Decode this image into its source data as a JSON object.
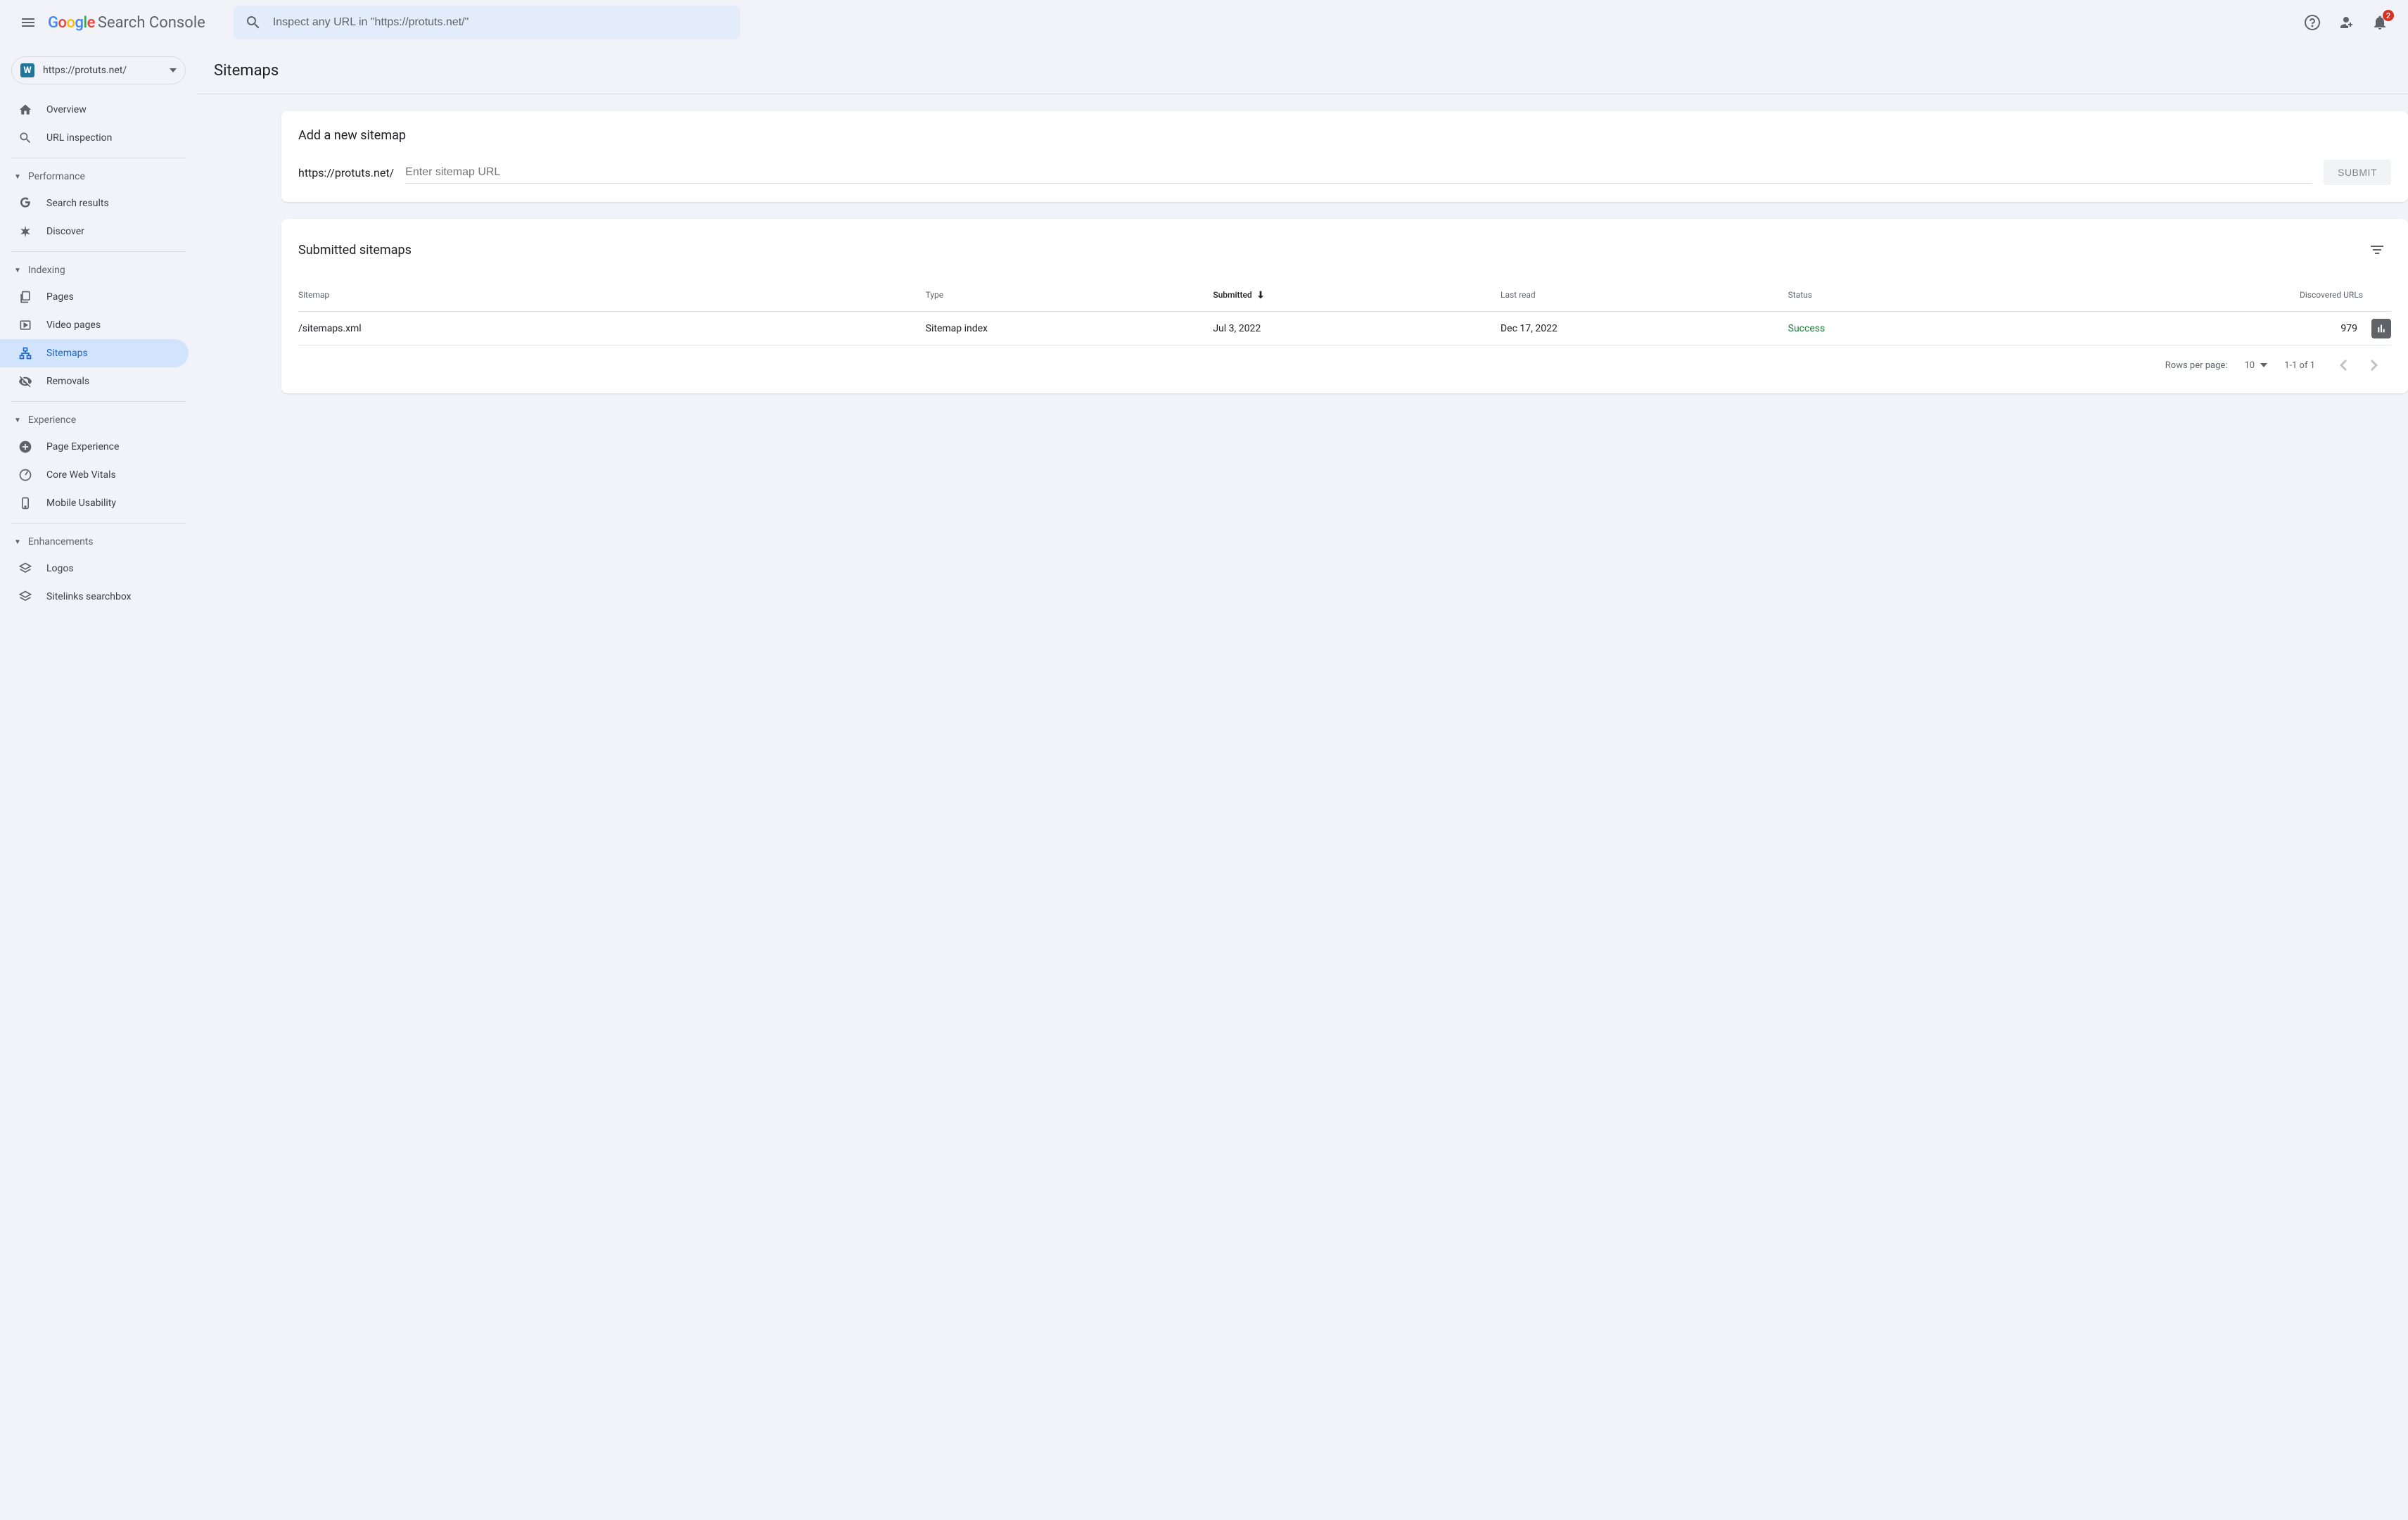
{
  "header": {
    "product_name": "Search Console",
    "search_placeholder": "Inspect any URL in \"https://protuts.net/\"",
    "notification_count": "2"
  },
  "property": {
    "url": "https://protuts.net/"
  },
  "nav": {
    "overview": "Overview",
    "url_inspection": "URL inspection",
    "section_performance": "Performance",
    "search_results": "Search results",
    "discover": "Discover",
    "section_indexing": "Indexing",
    "pages": "Pages",
    "video_pages": "Video pages",
    "sitemaps": "Sitemaps",
    "removals": "Removals",
    "section_experience": "Experience",
    "page_experience": "Page Experience",
    "core_web_vitals": "Core Web Vitals",
    "mobile_usability": "Mobile Usability",
    "section_enhancements": "Enhancements",
    "logos": "Logos",
    "sitelinks_searchbox": "Sitelinks searchbox"
  },
  "main": {
    "title": "Sitemaps",
    "add_card": {
      "title": "Add a new sitemap",
      "prefix": "https://protuts.net/",
      "placeholder": "Enter sitemap URL",
      "submit": "SUBMIT"
    },
    "list_card": {
      "title": "Submitted sitemaps",
      "cols": {
        "sitemap": "Sitemap",
        "type": "Type",
        "submitted": "Submitted",
        "last_read": "Last read",
        "status": "Status",
        "urls": "Discovered URLs"
      },
      "rows": [
        {
          "sitemap": "/sitemaps.xml",
          "type": "Sitemap index",
          "submitted": "Jul 3, 2022",
          "last_read": "Dec 17, 2022",
          "status": "Success",
          "urls": "979"
        }
      ],
      "pagination": {
        "rows_label": "Rows per page:",
        "rows_value": "10",
        "range": "1-1 of 1"
      }
    }
  }
}
